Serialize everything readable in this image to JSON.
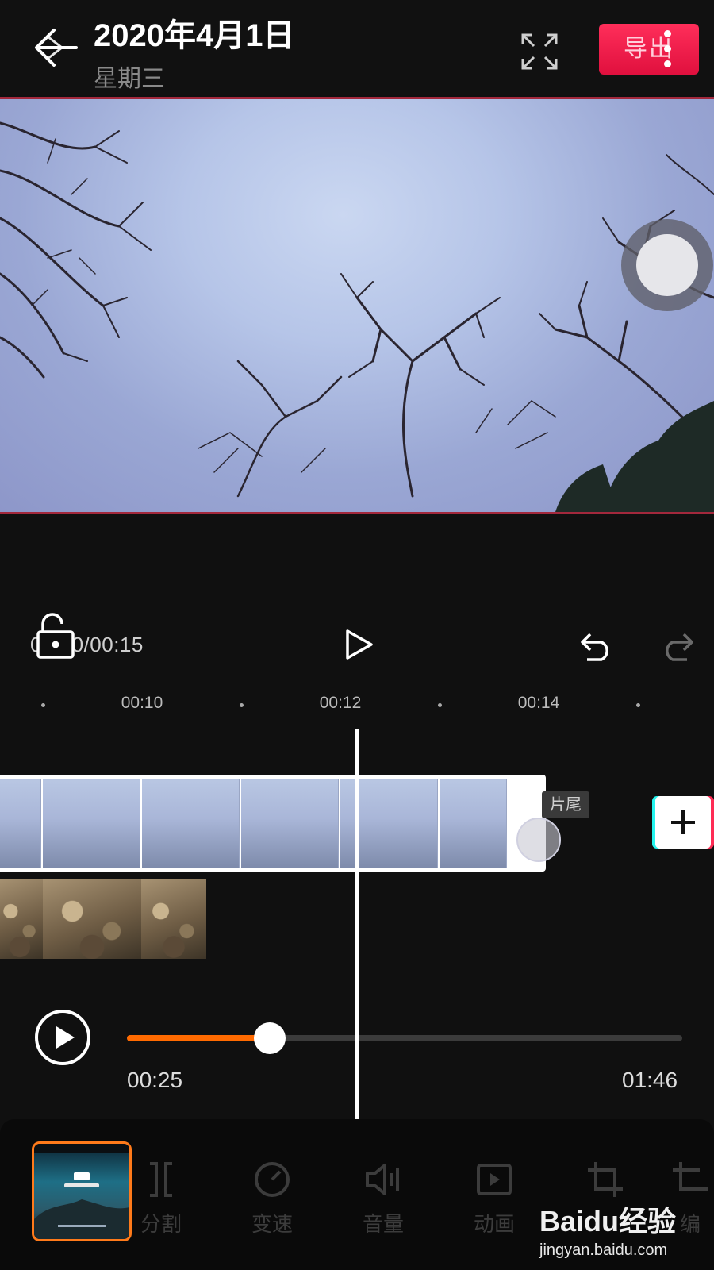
{
  "header": {
    "title": "2020年4月1日",
    "subtitle": "星期三",
    "export_label": "导出"
  },
  "player": {
    "time_display": "00:10/00:15"
  },
  "timeline": {
    "ticks": [
      "00:10",
      "00:12",
      "00:14"
    ],
    "tail_label": "片尾"
  },
  "progress": {
    "current": "00:25",
    "total": "01:46",
    "fraction": 0.257,
    "fill_color": "#ff6a00"
  },
  "toolbar": {
    "items": [
      {
        "label": "分割",
        "icon": "split-icon"
      },
      {
        "label": "变速",
        "icon": "speed-icon"
      },
      {
        "label": "音量",
        "icon": "volume-icon"
      },
      {
        "label": "动画",
        "icon": "animation-icon"
      },
      {
        "label": "",
        "icon": "crop-icon"
      },
      {
        "label": "编",
        "icon": "edit-icon"
      }
    ]
  },
  "watermark": {
    "logo": "Baidu经验",
    "url": "jingyan.baidu.com"
  },
  "colors": {
    "export_button": "#f0194a",
    "accent_orange": "#ff7a1a",
    "preview_border": "#a3283c"
  }
}
